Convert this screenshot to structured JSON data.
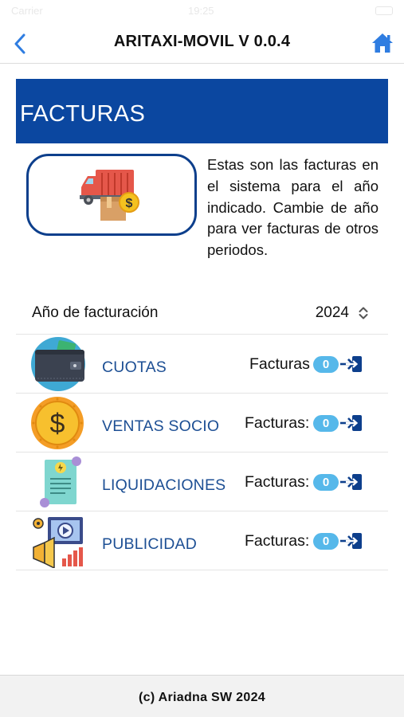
{
  "status_bar": {
    "carrier": "Carrier",
    "time": "19:25"
  },
  "nav": {
    "title": "ARITAXI-MOVIL V 0.0.4",
    "back_icon": "chevron-left-icon",
    "home_icon": "home-icon",
    "accent_color": "#2f7de1"
  },
  "banner": {
    "title": "FACTURAS",
    "color": "#0b47a0"
  },
  "intro": {
    "image_icon": "delivery-truck-money-icon",
    "text": "Estas son las facturas en el sistema para el año indicado. Cambie de año para ver facturas de otros periodos."
  },
  "year_selector": {
    "label": "Año de facturación",
    "value": "2024"
  },
  "items": [
    {
      "label": "CUOTAS",
      "facturas_label": "Facturas",
      "count": "0",
      "icon": "wallet-icon"
    },
    {
      "label": "VENTAS SOCIO",
      "facturas_label": "Facturas:",
      "count": "0",
      "icon": "dollar-coin-icon"
    },
    {
      "label": "LIQUIDACIONES",
      "facturas_label": "Facturas:",
      "count": "0",
      "icon": "receipt-icon"
    },
    {
      "label": "PUBLICIDAD",
      "facturas_label": "Facturas:",
      "count": "0",
      "icon": "advertising-megaphone-icon"
    }
  ],
  "footer": {
    "text": "(c) Ariadna SW 2024"
  }
}
